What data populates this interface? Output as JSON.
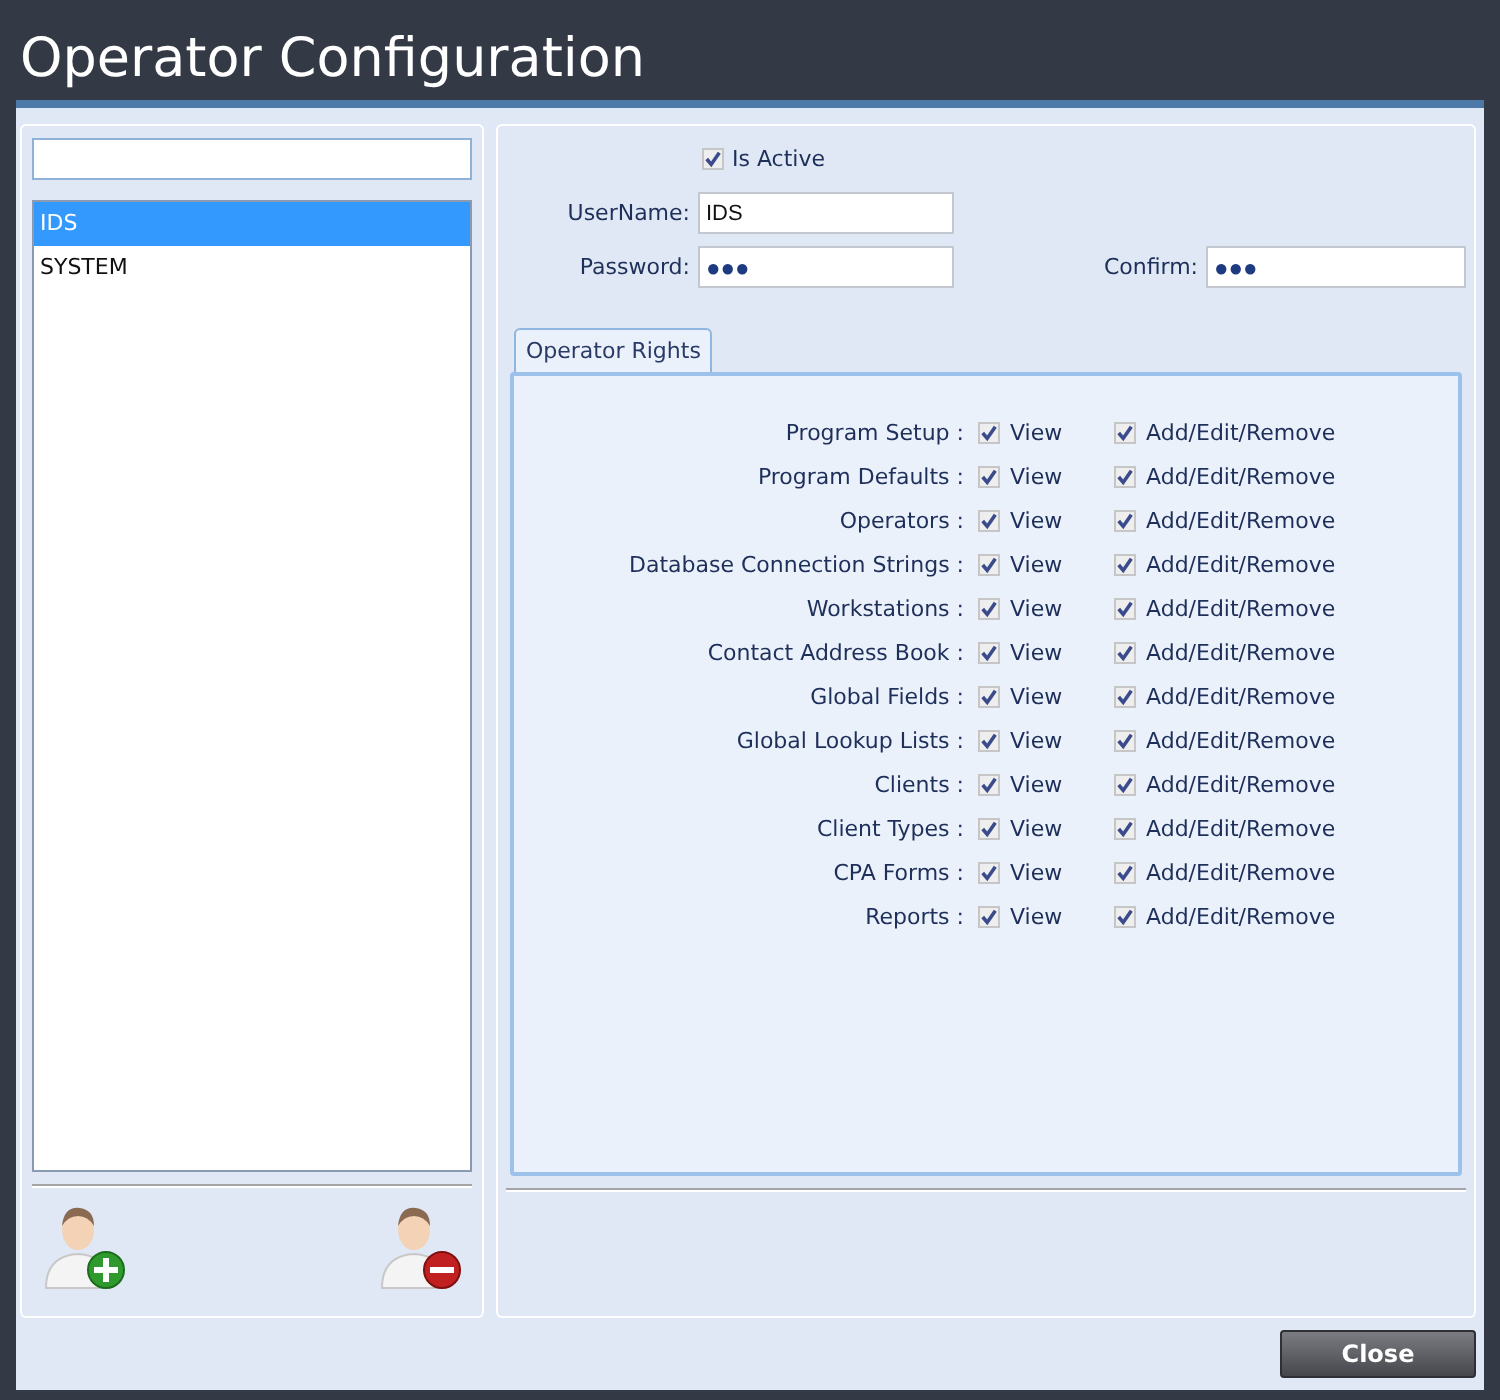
{
  "window": {
    "title": "Operator Configuration"
  },
  "operators": [
    {
      "name": "IDS",
      "selected": true
    },
    {
      "name": "SYSTEM",
      "selected": false
    }
  ],
  "is_active": {
    "label": "Is Active",
    "checked": true
  },
  "username": {
    "label": "UserName:",
    "value": "IDS"
  },
  "password": {
    "label": "Password:",
    "value": "●●●"
  },
  "confirm": {
    "label": "Confirm:",
    "value": "●●●"
  },
  "tabs": [
    {
      "label": "Operator Rights",
      "selected": true
    }
  ],
  "rights": [
    {
      "label": "Program Setup :",
      "view_label": "View",
      "view": true,
      "edit_label": "Add/Edit/Remove",
      "edit": true
    },
    {
      "label": "Program Defaults :",
      "view_label": "View",
      "view": true,
      "edit_label": "Add/Edit/Remove",
      "edit": true
    },
    {
      "label": "Operators :",
      "view_label": "View",
      "view": true,
      "edit_label": "Add/Edit/Remove",
      "edit": true
    },
    {
      "label": "Database Connection Strings :",
      "view_label": "View",
      "view": true,
      "edit_label": "Add/Edit/Remove",
      "edit": true
    },
    {
      "label": "Workstations :",
      "view_label": "View",
      "view": true,
      "edit_label": "Add/Edit/Remove",
      "edit": true
    },
    {
      "label": "Contact Address Book :",
      "view_label": "View",
      "view": true,
      "edit_label": "Add/Edit/Remove",
      "edit": true
    },
    {
      "label": "Global Fields :",
      "view_label": "View",
      "view": true,
      "edit_label": "Add/Edit/Remove",
      "edit": true
    },
    {
      "label": "Global Lookup Lists :",
      "view_label": "View",
      "view": true,
      "edit_label": "Add/Edit/Remove",
      "edit": true
    },
    {
      "label": "Clients :",
      "view_label": "View",
      "view": true,
      "edit_label": "Add/Edit/Remove",
      "edit": true
    },
    {
      "label": "Client Types :",
      "view_label": "View",
      "view": true,
      "edit_label": "Add/Edit/Remove",
      "edit": true
    },
    {
      "label": "CPA Forms :",
      "view_label": "View",
      "view": true,
      "edit_label": "Add/Edit/Remove",
      "edit": true
    },
    {
      "label": "Reports :",
      "view_label": "View",
      "view": true,
      "edit_label": "Add/Edit/Remove",
      "edit": true
    }
  ],
  "buttons": [
    {
      "label": "Close"
    }
  ]
}
